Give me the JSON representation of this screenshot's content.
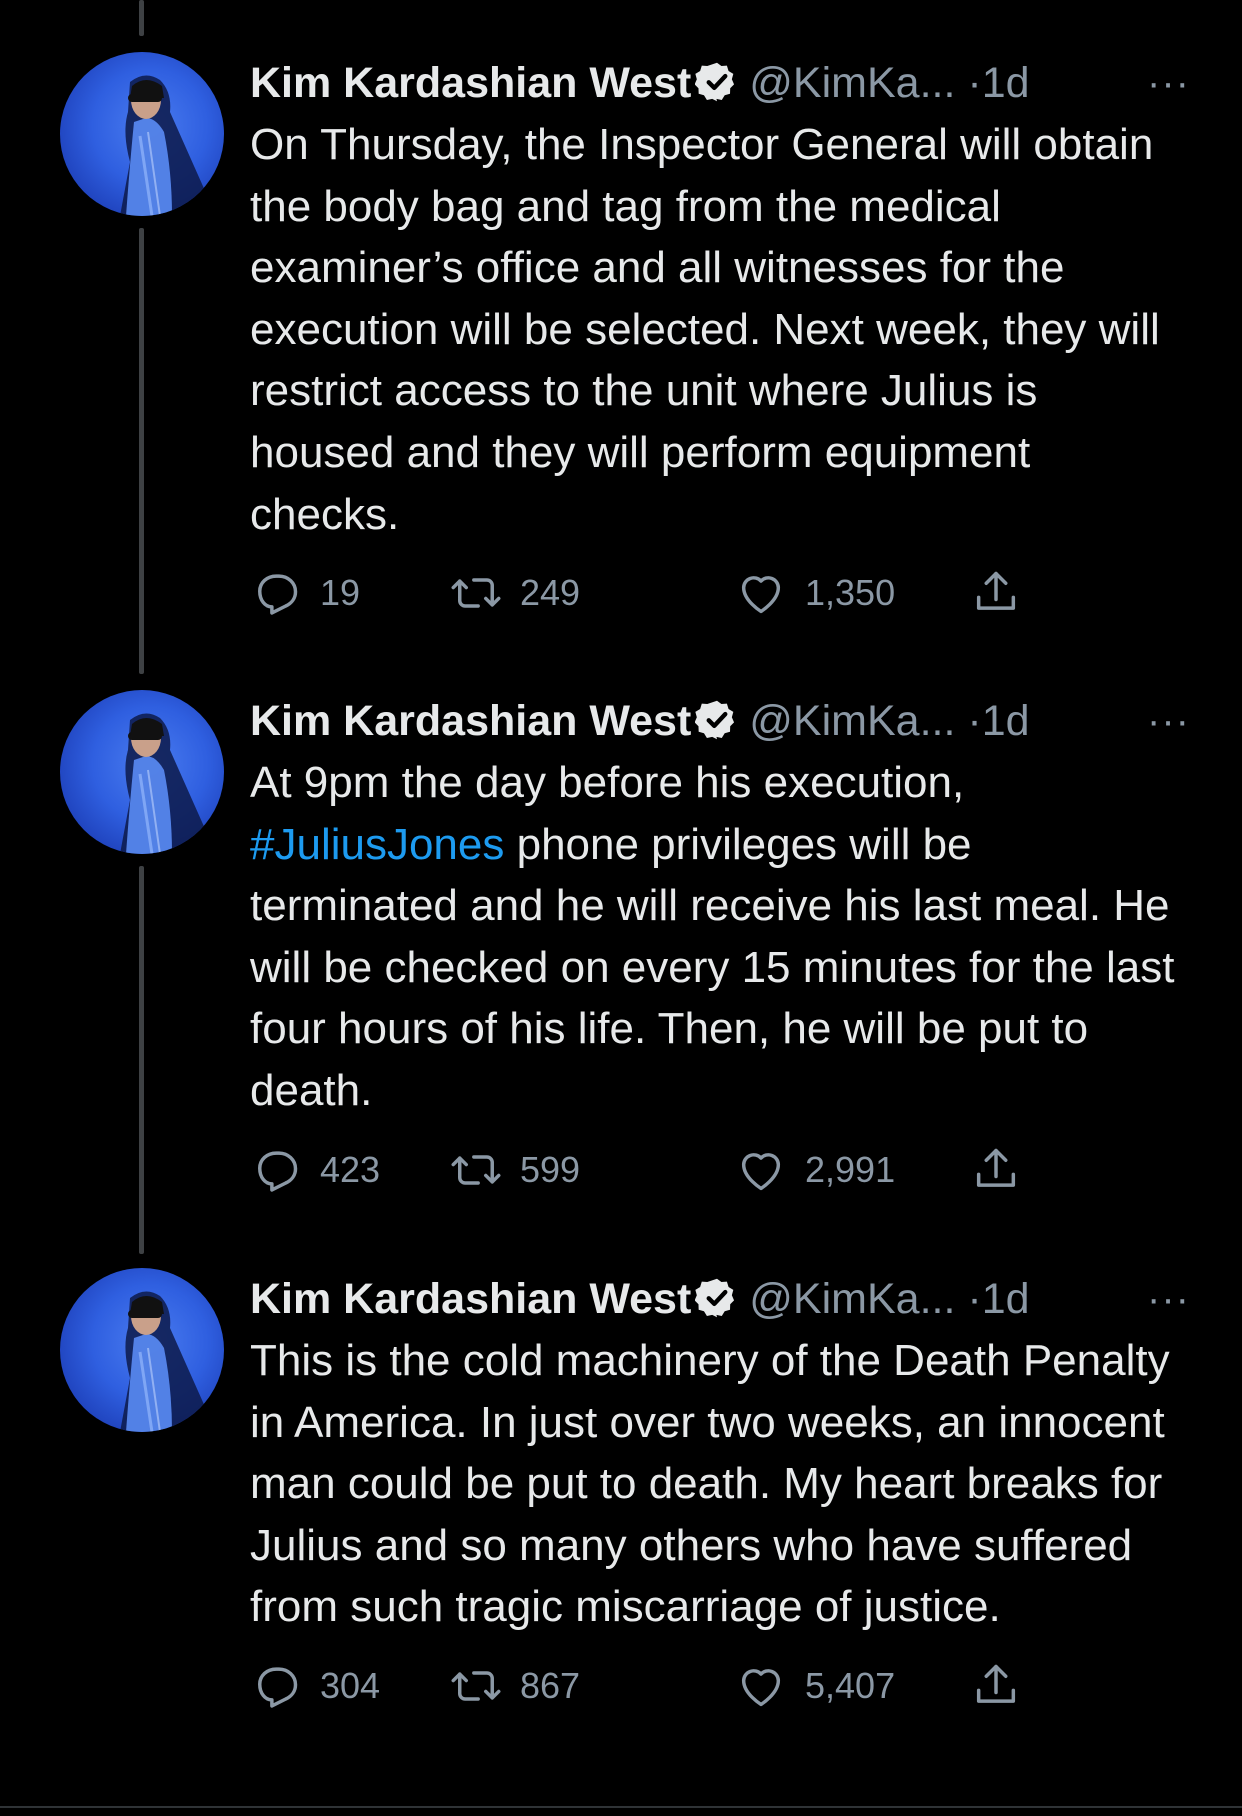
{
  "colors": {
    "background": "#000000",
    "text": "#e7e9ea",
    "muted": "#8b98a5",
    "link": "#1d9bf0",
    "thread_line": "#3e4144"
  },
  "tweets": [
    {
      "name": "Kim Kardashian West",
      "handle": "@KimKa...",
      "dot": "·",
      "time": "1d",
      "more": "···",
      "text_before": "On Thursday, the Inspector General will obtain the body bag and tag from the medical examiner’s office and all witnesses for the execution will be selected. Next week, they will restrict access to the unit where Julius is housed and they will perform equipment checks.",
      "hashtag": "",
      "text_after": "",
      "replies": "19",
      "retweets": "249",
      "likes": "1,350"
    },
    {
      "name": "Kim Kardashian West",
      "handle": "@KimKa...",
      "dot": "·",
      "time": "1d",
      "more": "···",
      "text_before": "At 9pm the day before his execution, ",
      "hashtag": "#JuliusJones",
      "text_after": " phone privileges will be terminated and he will receive his last meal. He will be checked on every 15 minutes for the last four hours of his life. Then, he will be put to death.",
      "replies": "423",
      "retweets": "599",
      "likes": "2,991"
    },
    {
      "name": "Kim Kardashian West",
      "handle": "@KimKa...",
      "dot": "·",
      "time": "1d",
      "more": "···",
      "text_before": "This is the cold machinery of the Death Penalty in America. In just over two weeks, an innocent man could be put to death. My heart breaks for Julius and so many others who have suffered from such tragic miscarriage of justice.",
      "hashtag": "",
      "text_after": "",
      "replies": "304",
      "retweets": "867",
      "likes": "5,407"
    }
  ]
}
